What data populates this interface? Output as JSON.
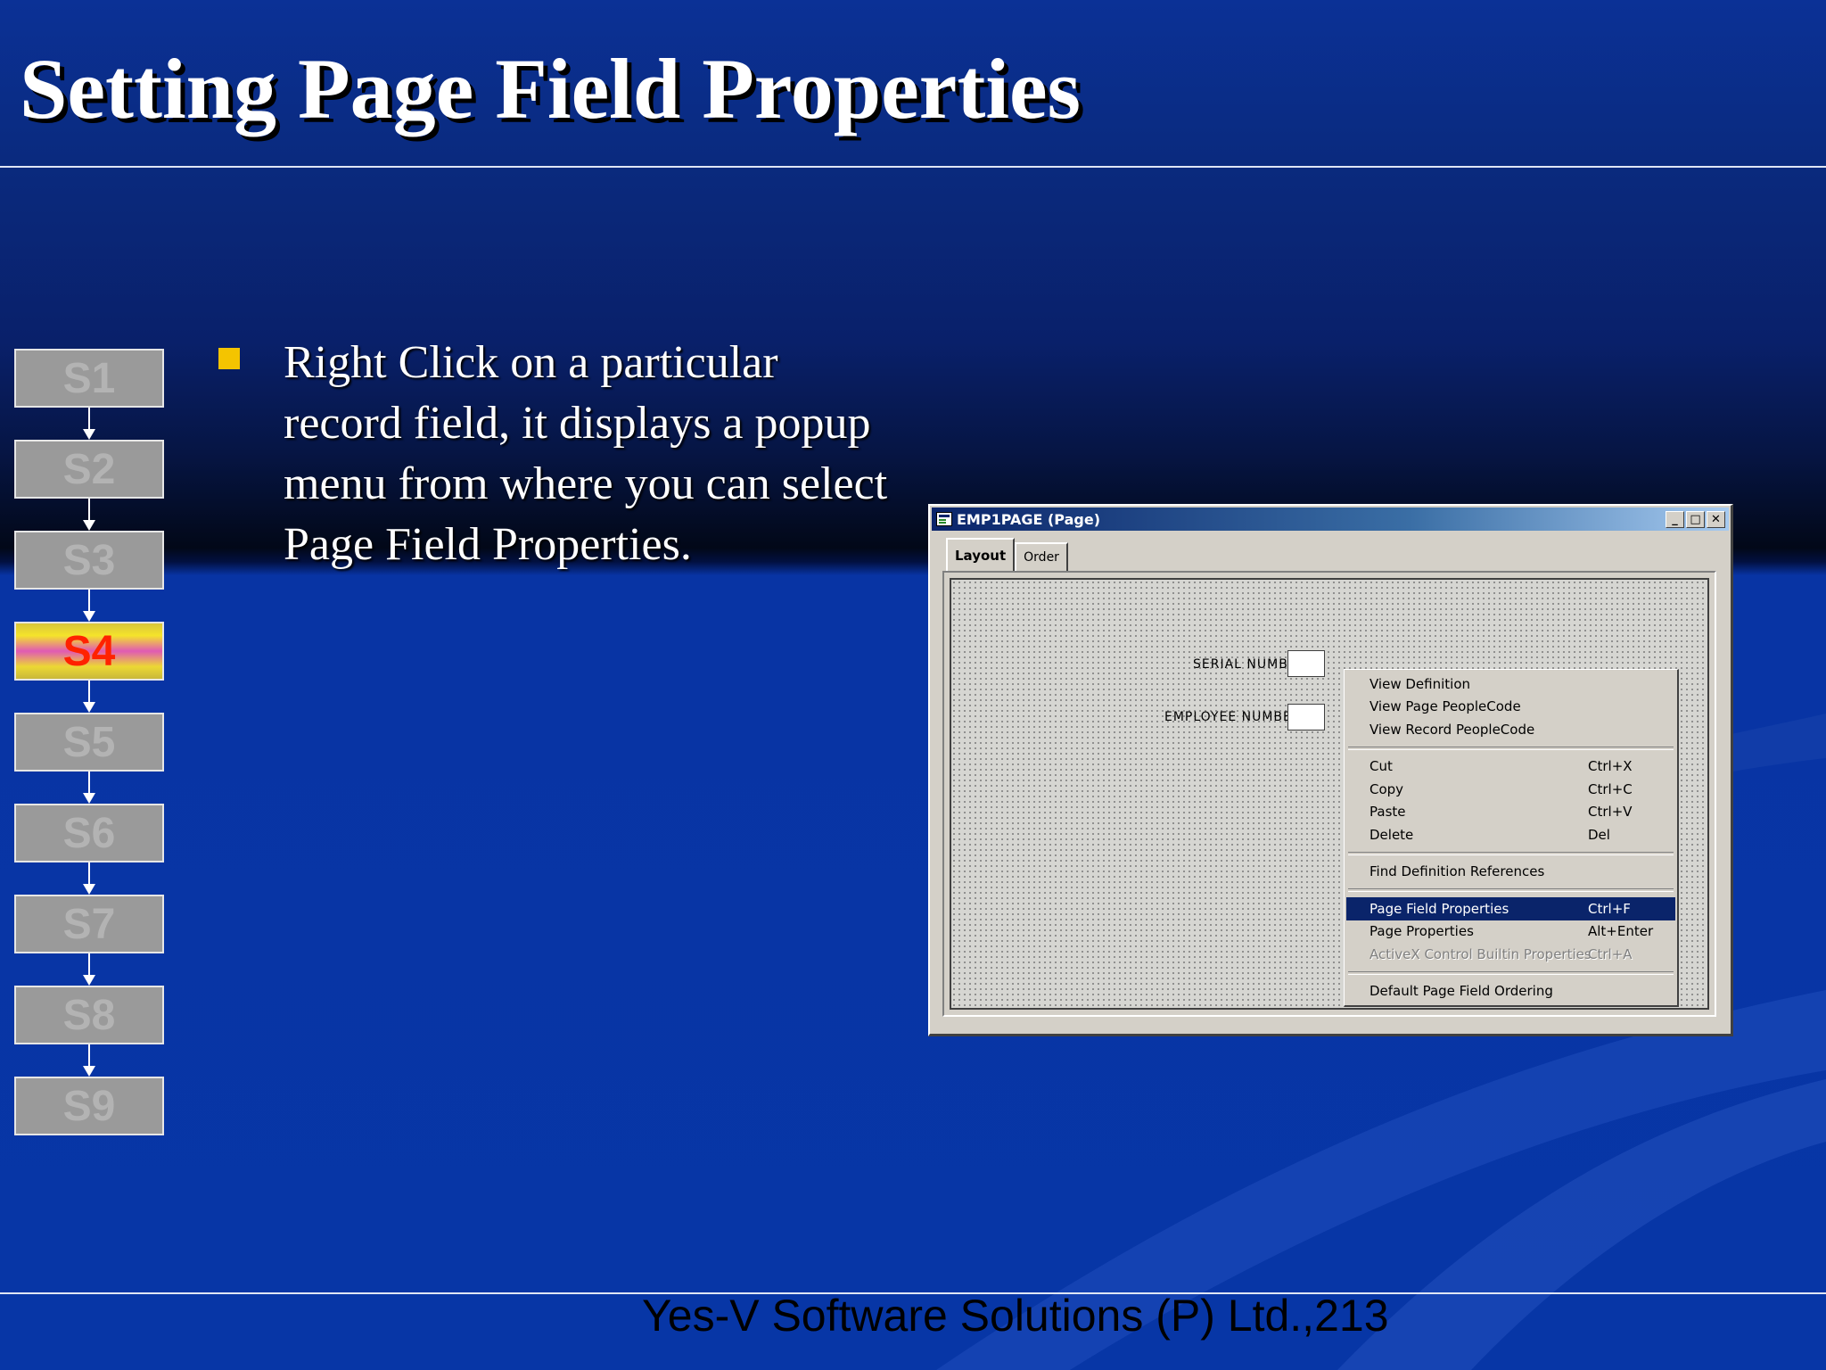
{
  "slide": {
    "title": "Setting Page Field Properties",
    "bullet": "Right Click on a particular record field, it displays a popup menu from where you can select Page Field Properties.",
    "footer": "Yes-V Software Solutions (P) Ltd.,213"
  },
  "steps": {
    "items": [
      "S1",
      "S2",
      "S3",
      "S4",
      "S5",
      "S6",
      "S7",
      "S8",
      "S9"
    ],
    "active_label": "S4"
  },
  "window": {
    "title": "EMP1PAGE (Page)",
    "tabs": [
      {
        "label": "Layout",
        "active": true
      },
      {
        "label": "Order",
        "active": false
      }
    ],
    "fields": {
      "serial_label": "SERIAL NUMBER:",
      "employee_label": "EMPLOYEE NUMBER:"
    }
  },
  "context_menu": {
    "items": [
      {
        "label": "View Definition",
        "shortcut": ""
      },
      {
        "label": "View Page PeopleCode",
        "shortcut": ""
      },
      {
        "label": "View Record PeopleCode",
        "shortcut": ""
      },
      {
        "label": "Cut",
        "shortcut": "Ctrl+X"
      },
      {
        "label": "Copy",
        "shortcut": "Ctrl+C"
      },
      {
        "label": "Paste",
        "shortcut": "Ctrl+V"
      },
      {
        "label": "Delete",
        "shortcut": "Del"
      },
      {
        "label": "Find Definition References",
        "shortcut": ""
      },
      {
        "label": "Page Field Properties",
        "shortcut": "Ctrl+F"
      },
      {
        "label": "Page Properties",
        "shortcut": "Alt+Enter"
      },
      {
        "label": "ActiveX Control Builtin Properties",
        "shortcut": "Ctrl+A"
      },
      {
        "label": "Default Page Field Ordering",
        "shortcut": ""
      }
    ],
    "selected_label": "Page Field Properties",
    "disabled_label": "ActiveX Control Builtin Properties"
  },
  "colors": {
    "bullet_accent": "#f4c400",
    "active_step_text": "#ff2200",
    "menu_highlight": "#0a246a"
  },
  "icons": {
    "bullet": "square-bullet",
    "window": "page-definition-icon",
    "minimize": "minimize-icon",
    "maximize": "maximize-icon",
    "close": "close-icon"
  }
}
